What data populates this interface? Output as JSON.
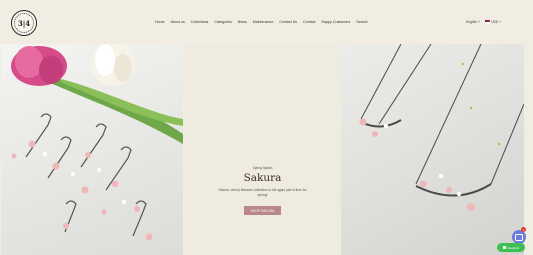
{
  "header": {
    "logo_text": "3|4",
    "nav": [
      "Home",
      "About us",
      "Collections",
      "Categories",
      "News",
      "Maintenance",
      "Contact Us",
      "Contact",
      "Happy Customers",
      "Search"
    ],
    "language": "English",
    "currency": "USD"
  },
  "hero": {
    "eyebrow": "Spring Splash",
    "title": "Sakura",
    "description": "Sakura, cherry blossom collection is full again just in time for spring!",
    "cta": "SHOP SAKURA"
  },
  "widgets": {
    "chat_badge": "1",
    "rewards_label": "Rewards"
  },
  "colors": {
    "background": "#f1ede2",
    "cta": "#b9878a",
    "rewards": "#3fbf52",
    "chat": "#6b7ce0"
  }
}
